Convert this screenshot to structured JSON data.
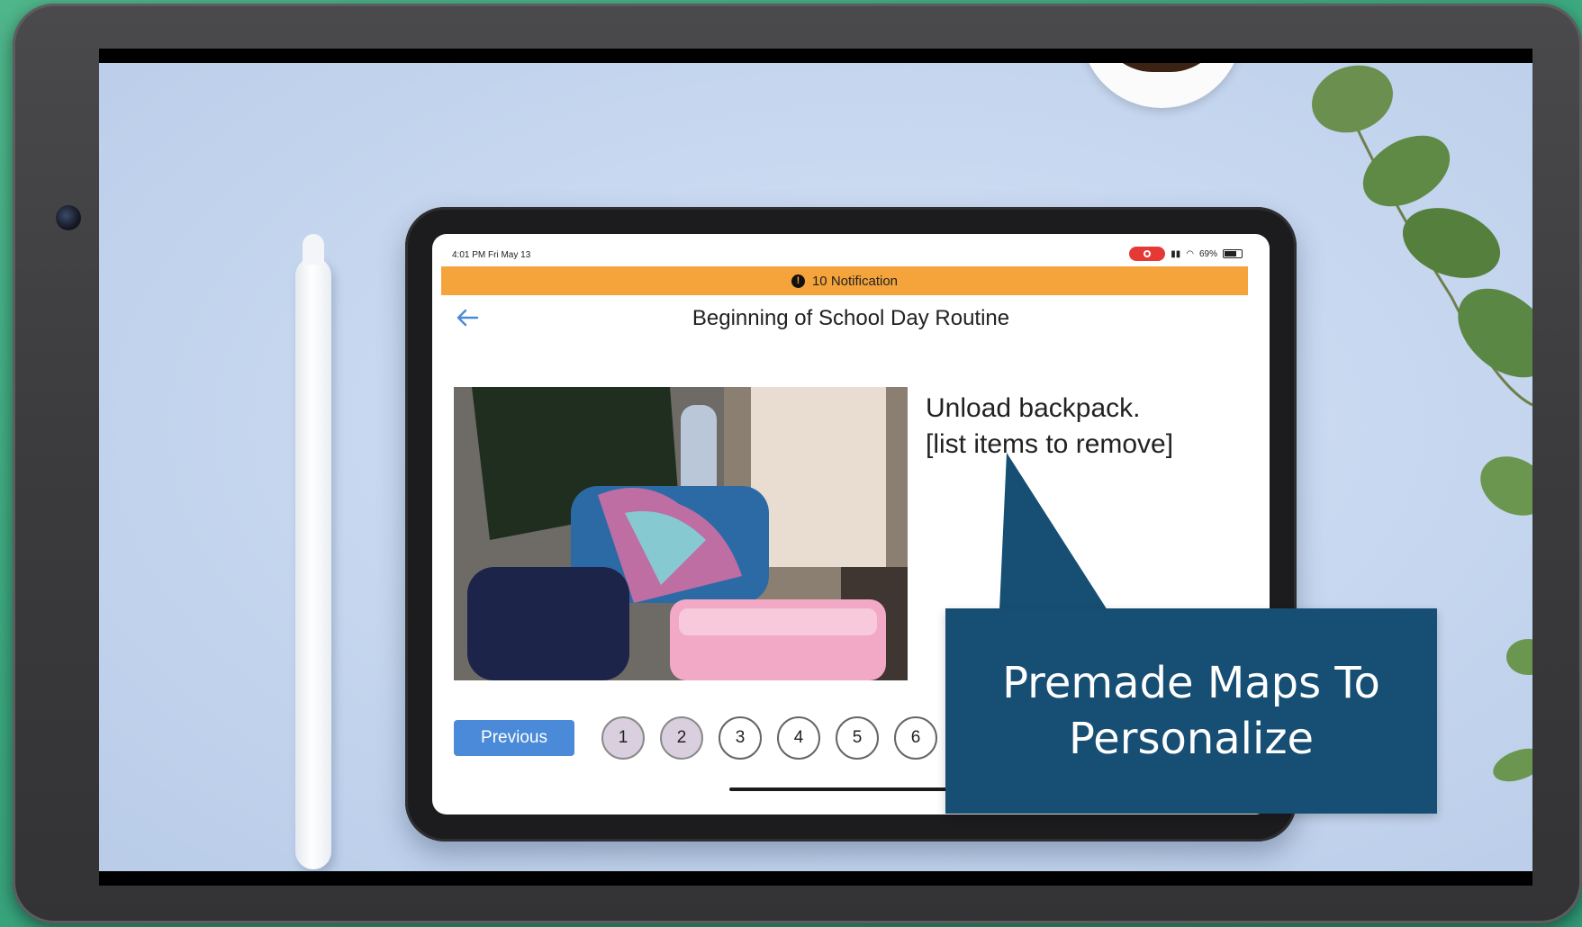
{
  "ipad": {
    "status_time": "4:01 PM  Fri May 13",
    "status_battery": "69%",
    "notification": {
      "icon": "alert-circle-icon",
      "text": "10 Notification"
    },
    "title": "Beginning of School Day Routine",
    "back_icon": "back-arrow-icon",
    "step_text_line1": "Unload backpack.",
    "step_text_line2": "[list items to remove]",
    "previous_label": "Previous",
    "pages": [
      {
        "label": "1",
        "visited": true
      },
      {
        "label": "2",
        "visited": true
      },
      {
        "label": "3",
        "visited": false
      },
      {
        "label": "4",
        "visited": false
      },
      {
        "label": "5",
        "visited": false
      },
      {
        "label": "6",
        "visited": false
      }
    ]
  },
  "callout": {
    "line1": "Premade Maps To",
    "line2": "Personalize"
  },
  "colors": {
    "notification_bar": "#f5a33b",
    "previous_button": "#4a8ad8",
    "callout": "#174e73",
    "page_visited": "#d9cfde"
  }
}
